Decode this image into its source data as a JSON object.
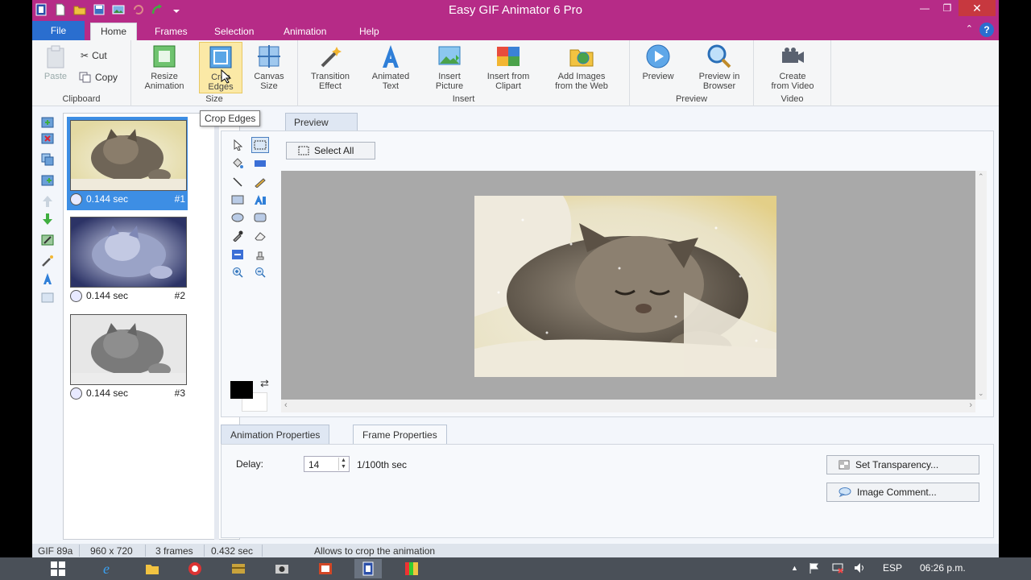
{
  "window": {
    "title": "Easy GIF Animator 6 Pro"
  },
  "ribbon_tabs": {
    "file": "File",
    "home": "Home",
    "frames": "Frames",
    "selection": "Selection",
    "animation": "Animation",
    "help": "Help"
  },
  "clipboard": {
    "paste": "Paste",
    "cut": "Cut",
    "copy": "Copy",
    "group": "Clipboard"
  },
  "size_group": {
    "resize_1": "Resize",
    "resize_2": "Animation",
    "crop_1": "Crop",
    "crop_2": "Edges",
    "canvas_1": "Canvas",
    "canvas_2": "Size",
    "group": "Size"
  },
  "insert_group": {
    "transition_1": "Transition",
    "transition_2": "Effect",
    "animtext_1": "Animated",
    "animtext_2": "Text",
    "picture_1": "Insert",
    "picture_2": "Picture",
    "clipart_1": "Insert from",
    "clipart_2": "Clipart",
    "web_1": "Add Images",
    "web_2": "from the Web",
    "group": "Insert"
  },
  "preview_group": {
    "preview": "Preview",
    "browser_1": "Preview in",
    "browser_2": "Browser",
    "group": "Preview"
  },
  "video_group": {
    "create_1": "Create",
    "create_2": "from Video",
    "group": "Video"
  },
  "tooltip": "Crop Edges",
  "frames": [
    {
      "duration": "0.144 sec",
      "number": "#1"
    },
    {
      "duration": "0.144 sec",
      "number": "#2"
    },
    {
      "duration": "0.144 sec",
      "number": "#3"
    }
  ],
  "preview_tab": "Preview",
  "select_all": "Select All",
  "properties": {
    "tab_animation": "Animation Properties",
    "tab_frame": "Frame Properties",
    "delay_label": "Delay:",
    "delay_value": "14",
    "delay_unit": "1/100th sec",
    "set_transparency": "Set Transparency...",
    "image_comment": "Image Comment..."
  },
  "status": {
    "format": "GIF 89a",
    "dimensions": "960 x 720",
    "frames": "3 frames",
    "duration": "0.432 sec",
    "hint": "Allows to crop the animation"
  },
  "taskbar": {
    "language": "ESP",
    "time": "06:26 p.m."
  },
  "colors": {
    "title_bar": "#b62b87",
    "file_tab": "#2a6ecf",
    "selected_frame": "#3d8ee4",
    "canvas_bg": "#a9a9a9"
  }
}
